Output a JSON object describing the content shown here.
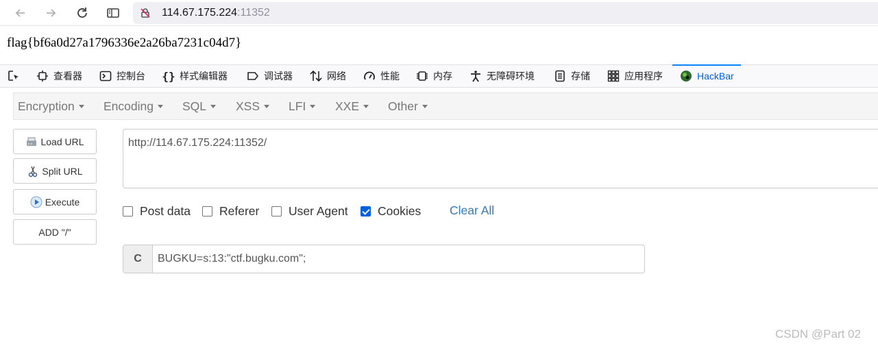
{
  "browser": {
    "url_host": "114.67.175.224",
    "url_port": ":11352"
  },
  "page": {
    "flag": "flag{bf6a0d27a1796336e2a26ba7231c04d7}"
  },
  "devtools": {
    "tabs": [
      {
        "label": "查看器",
        "icon": "inspector-icon"
      },
      {
        "label": "控制台",
        "icon": "console-icon"
      },
      {
        "label": "样式编辑器",
        "icon": "style-editor-icon"
      },
      {
        "label": "调试器",
        "icon": "debugger-icon"
      },
      {
        "label": "网络",
        "icon": "network-icon"
      },
      {
        "label": "性能",
        "icon": "performance-icon"
      },
      {
        "label": "内存",
        "icon": "memory-icon"
      },
      {
        "label": "无障碍环境",
        "icon": "accessibility-icon"
      },
      {
        "label": "存储",
        "icon": "storage-icon"
      },
      {
        "label": "应用程序",
        "icon": "application-icon"
      },
      {
        "label": "HackBar",
        "icon": "hackbar-icon",
        "active": true
      }
    ]
  },
  "hackbar": {
    "menu": [
      "Encryption",
      "Encoding",
      "SQL",
      "XSS",
      "LFI",
      "XXE",
      "Other"
    ],
    "buttons": {
      "load_url": "Load URL",
      "split_url": "Split URL",
      "execute": "Execute",
      "add_slash": "ADD \"/\""
    },
    "url": "http://114.67.175.224:11352/",
    "options": [
      {
        "label": "Post data",
        "checked": false
      },
      {
        "label": "Referer",
        "checked": false
      },
      {
        "label": "User Agent",
        "checked": false
      },
      {
        "label": "Cookies",
        "checked": true
      }
    ],
    "clear_all": "Clear All",
    "cookie_addon": "C",
    "cookie_value": "BUGKU=s:13:\"ctf.bugku.com\";"
  },
  "watermark": "CSDN @Part 02",
  "colors": {
    "accent": "#0a84ff",
    "link": "#337ab7",
    "checkbox": "#0060df"
  }
}
